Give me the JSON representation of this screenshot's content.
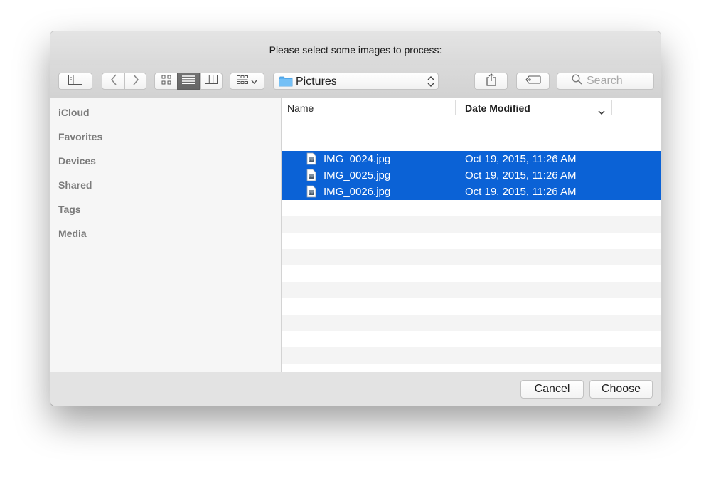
{
  "window": {
    "title": "Please select some images to process:"
  },
  "toolbar": {
    "location": "Pictures",
    "search_placeholder": "Search"
  },
  "sidebar": {
    "sections": [
      {
        "label": "iCloud"
      },
      {
        "label": "Favorites"
      },
      {
        "label": "Devices"
      },
      {
        "label": "Shared"
      },
      {
        "label": "Tags"
      },
      {
        "label": "Media"
      }
    ]
  },
  "file_list": {
    "columns": {
      "name": "Name",
      "date": "Date Modified"
    },
    "files": [
      {
        "name": "IMG_0024.jpg",
        "date": "Oct 19, 2015, 11:26 AM",
        "selected": true
      },
      {
        "name": "IMG_0025.jpg",
        "date": "Oct 19, 2015, 11:26 AM",
        "selected": true
      },
      {
        "name": "IMG_0026.jpg",
        "date": "Oct 19, 2015, 11:26 AM",
        "selected": true
      }
    ]
  },
  "footer": {
    "cancel_label": "Cancel",
    "choose_label": "Choose"
  },
  "colors": {
    "selection": "#0b62d6",
    "folder": "#5ab0f2"
  }
}
